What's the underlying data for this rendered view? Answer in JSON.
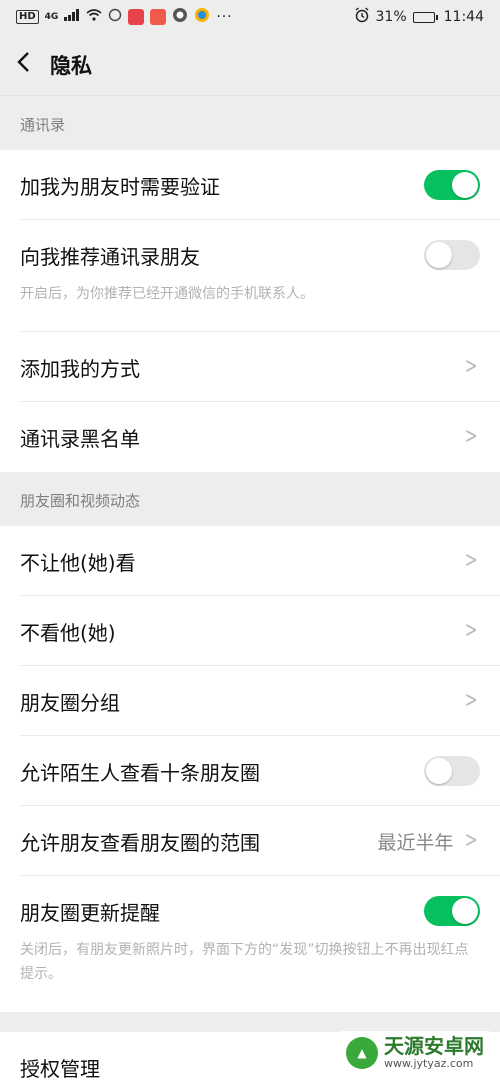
{
  "status": {
    "battery_percent": "31%",
    "battery_level": 0.31,
    "time": "11:44",
    "net": "4G"
  },
  "nav": {
    "title": "隐私"
  },
  "sections": {
    "contacts": {
      "header": "通讯录",
      "verify": {
        "label": "加我为朋友时需要验证",
        "on": true
      },
      "recommend": {
        "label": "向我推荐通讯录朋友",
        "on": false,
        "desc": "开启后，为你推荐已经开通微信的手机联系人。"
      },
      "add_methods": {
        "label": "添加我的方式"
      },
      "blacklist": {
        "label": "通讯录黑名单"
      }
    },
    "moments": {
      "header": "朋友圈和视频动态",
      "hide_from": {
        "label": "不让他(她)看"
      },
      "dont_see": {
        "label": "不看他(她)"
      },
      "groups": {
        "label": "朋友圈分组"
      },
      "strangers": {
        "label": "允许陌生人查看十条朋友圈",
        "on": false
      },
      "range": {
        "label": "允许朋友查看朋友圈的范围",
        "value": "最近半年"
      },
      "update_remind": {
        "label": "朋友圈更新提醒",
        "on": true,
        "desc": "关闭后，有朋友更新照片时，界面下方的“发现”切换按钮上不再出现红点提示。"
      }
    },
    "auth": {
      "label": "授权管理"
    }
  },
  "watermark": {
    "title": "天源安卓网",
    "url": "www.jytyaz.com"
  },
  "colors": {
    "toggle_on": "#07c160",
    "toggle_off": "#e5e5e5",
    "background": "#ededed"
  }
}
